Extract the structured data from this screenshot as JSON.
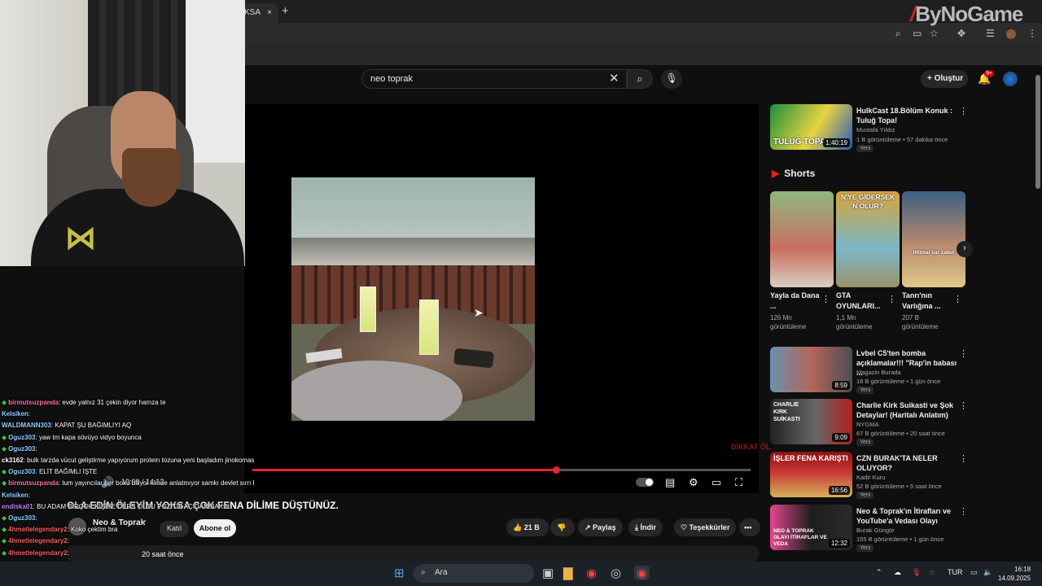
{
  "browser": {
    "tab_title": "KSA",
    "tab_close": "×",
    "new_tab": "+",
    "brand": "ByNoGame"
  },
  "youtube": {
    "search_value": "neo toprak",
    "create_label": "Oluştur",
    "notifications_badge": "9+"
  },
  "player": {
    "time": "10:09 / 14:13",
    "progress": 0.61,
    "watermark": "DİKKAT ÖL"
  },
  "video": {
    "title": "OLA EDİN ÖLEYİM YOKSA ÇOK FENA DİLİME DÜŞTÜNÜZ.",
    "channel": "Neo & Toprak",
    "join_label": "Katıl",
    "subscribe_label": "Abone ol",
    "likes": "21 B",
    "share_label": "Paylaş",
    "download_label": "İndir",
    "thanks_label": "Teşekkürler",
    "more_label": "•••",
    "desc_views": "20 saat önce"
  },
  "sidebar": {
    "top_video": {
      "title": "HulkCast 18.Bölüm Konuk : Tuluğ Topa!",
      "channel": "Mustafa Yıldız",
      "meta": "1 B görüntüleme • 57 dakika önce",
      "badge": "Yeni",
      "duration": "1:40:19",
      "thumb_text": "TULUĞ TOPA"
    },
    "shorts_label": "Shorts",
    "shorts": [
      {
        "title": "Yayla da Dana ...",
        "views": "126 Mn görüntüleme",
        "overlay": ""
      },
      {
        "title": "GTA OYUNLARI...",
        "views": "1,1 Mn görüntüleme",
        "overlay": "N'YE GİDERSEK N OLUR?"
      },
      {
        "title": "Tanrı'nın Varlığına ...",
        "views": "207 B görüntüleme",
        "overlay": "ihtimal var zaten"
      }
    ],
    "videos": [
      {
        "title": "Lvbel C5'ten bomba açıklamalar!!! \"Rap'in babası ...",
        "channel": "Magazin Burada",
        "meta": "18 B görüntüleme • 1 gün önce",
        "badge": "Yeni",
        "duration": "8:59",
        "thumb_text": ""
      },
      {
        "title": "Charlie Kirk Suikasti ve Şok Detaylar! (Haritalı Anlatım)",
        "channel": "NYGMA",
        "meta": "67 B görüntüleme • 20 saat önce",
        "badge": "Yeni",
        "duration": "9:09",
        "thumb_text": "CHARLIE KIRK SUİKASTI"
      },
      {
        "title": "CZN BURAK'TA NELER OLUYOR?",
        "channel": "Kadir Kuru",
        "meta": "52 B görüntüleme • 5 saat önce",
        "badge": "Yeni",
        "duration": "16:56",
        "thumb_text": "İŞLER FENA KARIŞTI"
      },
      {
        "title": "Neo & Toprak'ın İtirafları ve YouTube'a Vedası Olayı",
        "channel": "Burak Güngör",
        "meta": "155 B görüntüleme • 1 gün önce",
        "badge": "Yeni",
        "duration": "12:32",
        "thumb_text": "NEO & TOPRAK OLAYI İTİRAFLAR VE VEDA"
      }
    ]
  },
  "chat": [
    {
      "user": "birmutsuzpanda",
      "color": "#ff6fae",
      "badge": true,
      "text": ": evde yalnız 31 çekin diyor hamza te"
    },
    {
      "user": "Kelsiken",
      "color": "#8fd0ff",
      "badge": false,
      "text": ":"
    },
    {
      "user": "WALDMANN303",
      "color": "#8fd0ff",
      "badge": false,
      "text": ": KAPAT ŞU BAĞIMLIYI AQ"
    },
    {
      "user": "Oguz303",
      "color": "#8fd0ff",
      "badge": true,
      "text": ": yaw tm kapa sövüyo vidyo boyunca"
    },
    {
      "user": "Oguz303",
      "color": "#8fd0ff",
      "badge": true,
      "text": ":"
    },
    {
      "user": "ck3162",
      "color": "#ffffff",
      "badge": false,
      "text": ": bulk tarzda vücut geliştirme yapıyorum protein tozuna yeni başladım jinokomastiye sebep olur mu"
    },
    {
      "user": "Oguz303",
      "color": "#8fd0ff",
      "badge": true,
      "text": ": ELİT BAĞIMLI İŞTE"
    },
    {
      "user": "birmutsuzpanda",
      "color": "#ff6fae",
      "badge": true,
      "text": ": tum yayıncılar her boku biliyor kimse anlatmıyor samkı devlet sırrı bunlar anlatırlar"
    },
    {
      "user": "Kelsiken",
      "color": "#8fd0ff",
      "badge": false,
      "text": ":"
    },
    {
      "user": "endiska01",
      "color": "#c07cff",
      "badge": false,
      "text": ": BU ADAM BİRÇOK KİŞİYE DERS OLDU POZİTİF AÇIDAN BAKIN"
    },
    {
      "user": "Oguz303",
      "color": "#8fd0ff",
      "badge": true,
      "text": ":"
    },
    {
      "user": "4hmetlelegendary2",
      "color": "#ff5a5a",
      "badge": true,
      "text": ": Koko çektim bra"
    },
    {
      "user": "4hmetlelegendary2",
      "color": "#ff5a5a",
      "badge": true,
      "text": ":"
    },
    {
      "user": "4hmetlelegendary2",
      "color": "#ff5a5a",
      "badge": true,
      "text": ":"
    }
  ],
  "taskbar": {
    "search_placeholder": "Ara",
    "language": "TUR",
    "time": "16:18",
    "date": "14.09.2025"
  }
}
